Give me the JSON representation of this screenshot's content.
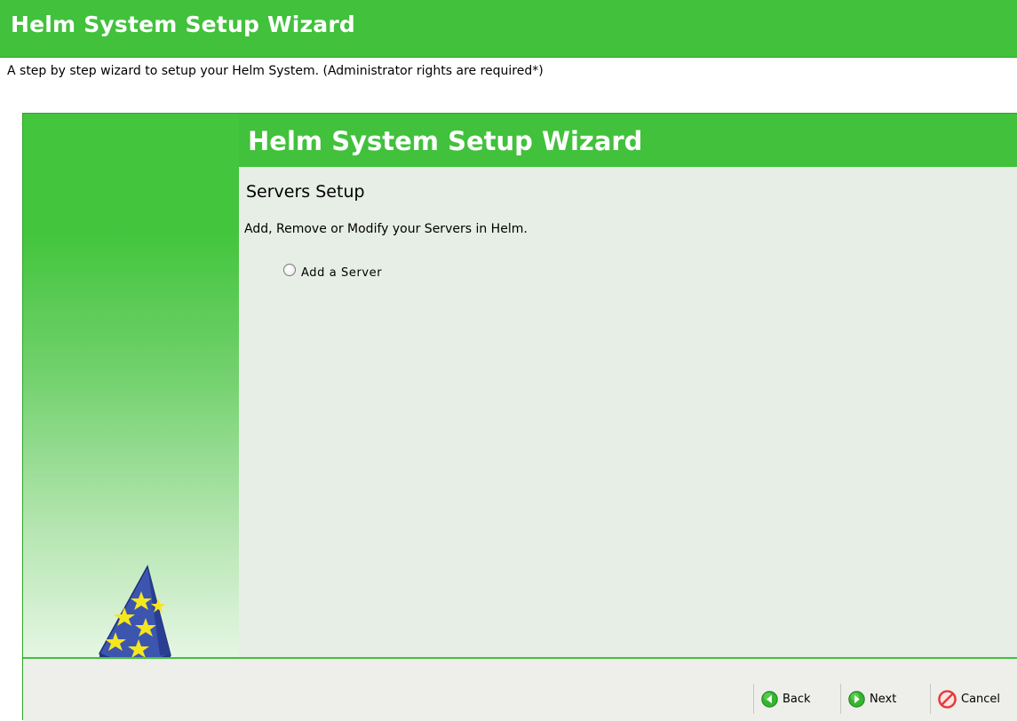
{
  "header": {
    "title": "Helm System Setup Wizard",
    "description": "A step by step wizard to setup your Helm System. (Administrator rights are required*)"
  },
  "wizard": {
    "banner_title": "Helm System Setup Wizard",
    "section_title": "Servers Setup",
    "section_description": "Add, Remove or Modify your Servers in Helm.",
    "options": [
      {
        "label": "Add a Server",
        "selected": false
      }
    ]
  },
  "footer": {
    "back_label": "Back",
    "next_label": "Next",
    "cancel_label": "Cancel"
  },
  "icons": {
    "back": "arrow-left-icon",
    "next": "arrow-right-icon",
    "cancel": "cancel-icon",
    "mascot": "wizard-hat-icon"
  },
  "colors": {
    "brand_green": "#41c13c",
    "content_bg": "#e7eee6",
    "footer_bg": "#eeeeea",
    "hat_blue": "#3c56b0",
    "star_yellow": "#f5e61e",
    "cancel_red": "#e23a3a"
  }
}
